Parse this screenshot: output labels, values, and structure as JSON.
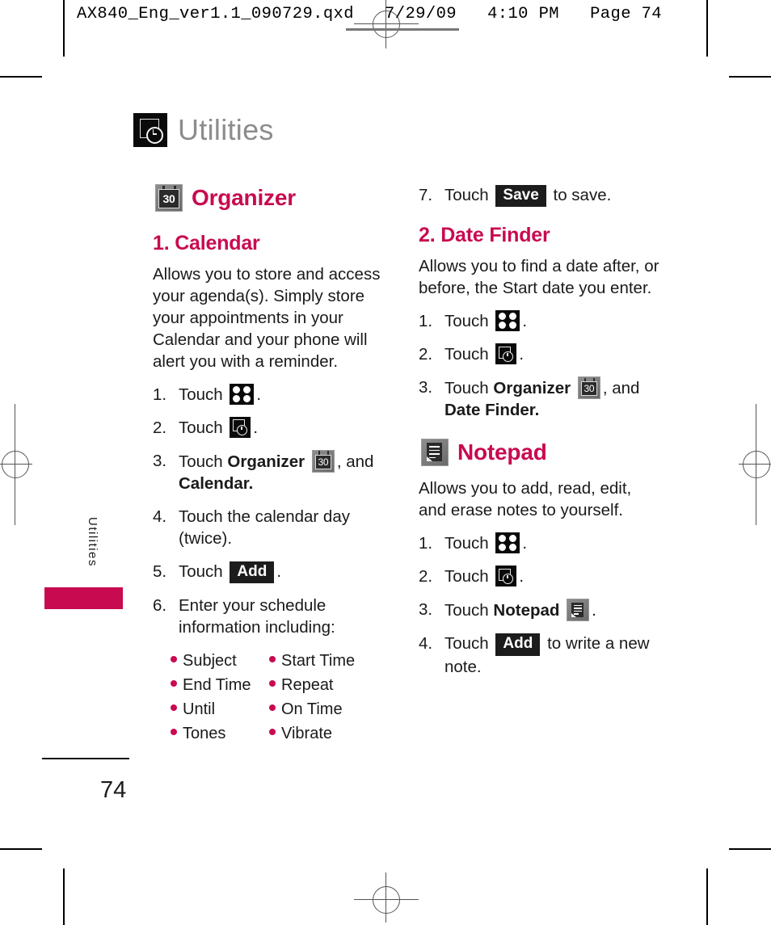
{
  "print_header": {
    "text": "AX840_Eng_ver1.1_090729.qxd   7/29/09   4:10 PM   Page 74"
  },
  "chapter": {
    "title": "Utilities",
    "icon": "utilities-icon"
  },
  "side_tab": {
    "label": "Utilities",
    "color": "#c80a50"
  },
  "footer": {
    "page_number": "74"
  },
  "colors": {
    "accent": "#c80a50",
    "chapter_title": "#8c8c8c",
    "body_text": "#1a1a1a",
    "key_background": "#1c1c1c"
  },
  "left_column": {
    "section": {
      "title": "Organizer",
      "icon": "calendar-icon"
    },
    "subsection": {
      "title": "1. Calendar",
      "body": "Allows you to store and access your agenda(s). Simply store your appointments in your Calendar and your phone will alert you with a reminder.",
      "steps": [
        {
          "num": "1.",
          "pre": "Touch",
          "icon": "menu-grid-icon",
          "post": "."
        },
        {
          "num": "2.",
          "pre": "Touch",
          "icon": "utilities-icon",
          "post": "."
        },
        {
          "num": "3.",
          "pre": "Touch",
          "bold": "Organizer",
          "icon": "calendar-icon",
          "post": ", and",
          "bold_after": "Calendar."
        },
        {
          "num": "4.",
          "text": "Touch the calendar day (twice)."
        },
        {
          "num": "5.",
          "pre": "Touch",
          "key": "Add",
          "post": "."
        },
        {
          "num": "6.",
          "text": "Enter your schedule information including:"
        }
      ],
      "bullets": [
        "Subject",
        "Start Time",
        "End Time",
        "Repeat",
        "Until",
        "On Time",
        "Tones",
        "Vibrate"
      ]
    }
  },
  "right_column": {
    "continued_step": {
      "num": "7.",
      "pre": "Touch",
      "key": "Save",
      "post": "to save."
    },
    "date_finder": {
      "title": "2. Date Finder",
      "body": "Allows you to find a date after, or before, the Start date you enter.",
      "steps": [
        {
          "num": "1.",
          "pre": "Touch",
          "icon": "menu-grid-icon",
          "post": "."
        },
        {
          "num": "2.",
          "pre": "Touch",
          "icon": "utilities-icon",
          "post": "."
        },
        {
          "num": "3.",
          "pre": "Touch",
          "bold": "Organizer",
          "icon": "calendar-icon",
          "post": ", and",
          "bold_after": "Date Finder."
        }
      ]
    },
    "notepad": {
      "title": "Notepad",
      "icon": "notepad-icon",
      "body": "Allows you to add, read, edit, and erase notes to yourself.",
      "steps": [
        {
          "num": "1.",
          "pre": "Touch",
          "icon": "menu-grid-icon",
          "post": "."
        },
        {
          "num": "2.",
          "pre": "Touch",
          "icon": "utilities-icon",
          "post": "."
        },
        {
          "num": "3.",
          "pre": "Touch",
          "bold": "Notepad",
          "icon": "notepad-icon",
          "post": "."
        },
        {
          "num": "4.",
          "pre": "Touch",
          "key": "Add",
          "post": "to write a new note."
        }
      ]
    }
  },
  "calendar_icon_label": "30"
}
